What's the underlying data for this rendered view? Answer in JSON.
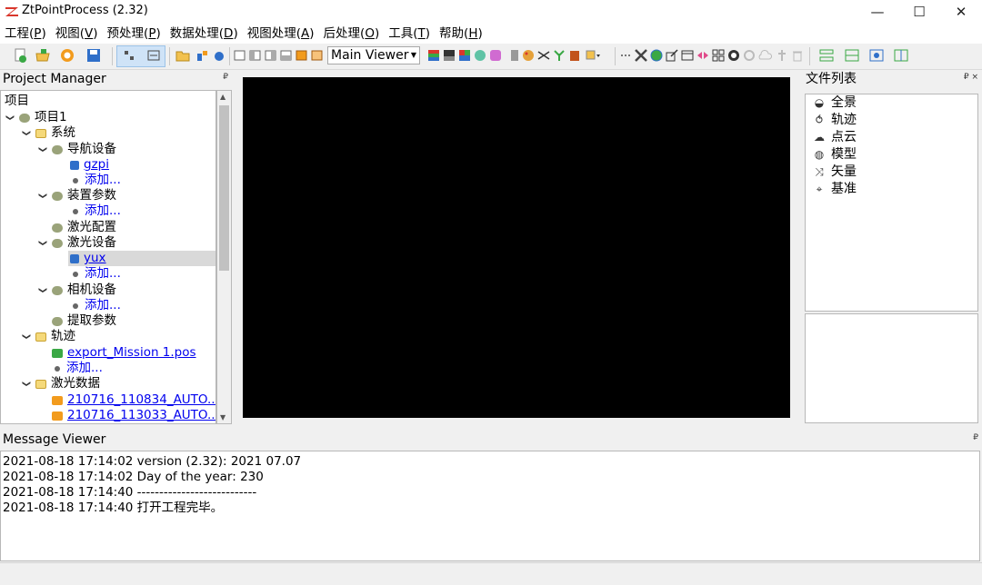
{
  "window": {
    "title": "ZtPointProcess (2.32)",
    "minimize": "—",
    "maximize": "☐",
    "close": "✕"
  },
  "menu": [
    {
      "label": "工程(",
      "key": "P",
      "end": ")"
    },
    {
      "label": "视图(",
      "key": "V",
      "end": ")"
    },
    {
      "label": "预处理(",
      "key": "P",
      "end": ")"
    },
    {
      "label": "数据处理(",
      "key": "D",
      "end": ")"
    },
    {
      "label": "视图处理(",
      "key": "A",
      "end": ")"
    },
    {
      "label": "后处理(",
      "key": "O",
      "end": ")"
    },
    {
      "label": "工具(",
      "key": "T",
      "end": ")"
    },
    {
      "label": "帮助(",
      "key": "H",
      "end": ")"
    }
  ],
  "toolbar": {
    "viewer_select": "Main Viewer",
    "colors": {
      "green": "#3aa845",
      "orange": "#f29b1d",
      "blue": "#2f6fc9",
      "red": "#d9362b"
    }
  },
  "project": {
    "title": "Project Manager",
    "pin": "₽",
    "header": "项目",
    "root": "项目1",
    "system": "系统",
    "nav_device": "导航设备",
    "nav_item": "gzpi",
    "add": "添加...",
    "device_params": "装置参数",
    "laser_config": "激光配置",
    "laser_device": "激光设备",
    "laser_item": "yux",
    "camera_device": "相机设备",
    "extract_params": "提取参数",
    "trajectory": "轨迹",
    "trajectory_item": "export_Mission 1.pos",
    "laser_data": "激光数据",
    "laser_data_item1": "210716_110834_AUTO...",
    "laser_data_item2": "210716_113033_AUTO..."
  },
  "file_list": {
    "title": "文件列表",
    "pin": "₽ ×",
    "items": [
      {
        "label": "全景",
        "icon": "panorama-icon"
      },
      {
        "label": "轨迹",
        "icon": "trajectory-icon"
      },
      {
        "label": "点云",
        "icon": "cloud-icon"
      },
      {
        "label": "模型",
        "icon": "model-icon"
      },
      {
        "label": "矢量",
        "icon": "vector-icon"
      },
      {
        "label": "基准",
        "icon": "datum-icon"
      }
    ]
  },
  "messages": {
    "title": "Message Viewer",
    "pin": "₽",
    "lines": [
      "2021-08-18 17:14:02 version (2.32): 2021 07.07",
      "2021-08-18 17:14:02 Day of the year: 230",
      "2021-08-18 17:14:40 ---------------------------",
      "2021-08-18 17:14:40 打开工程完毕。"
    ]
  }
}
